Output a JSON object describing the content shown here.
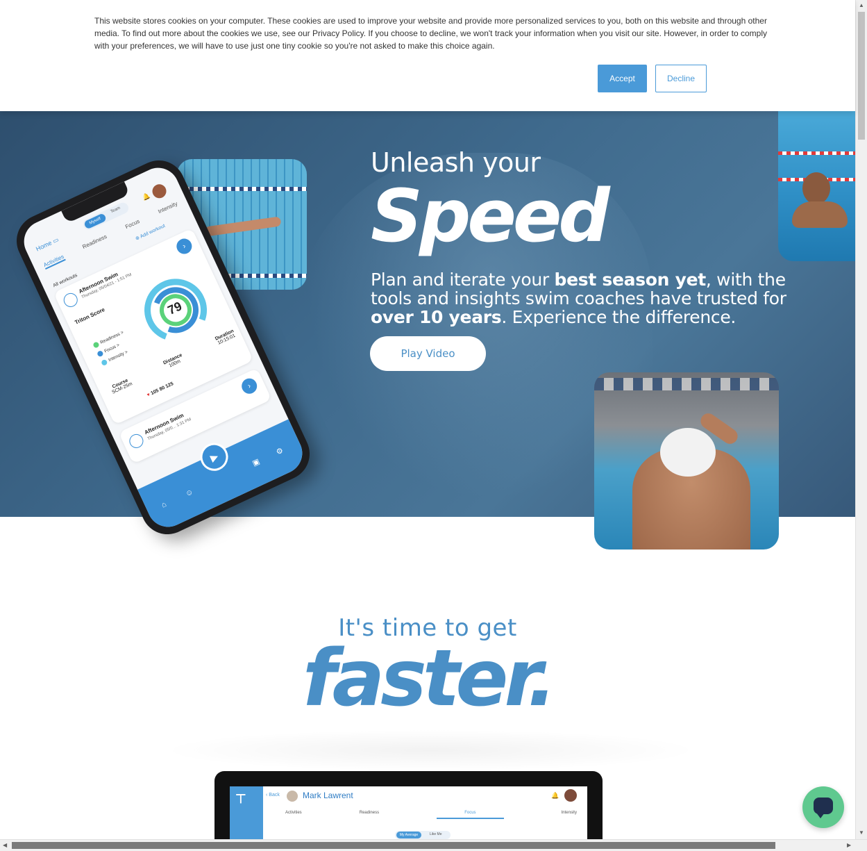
{
  "cookie_banner": {
    "text": "This website stores cookies on your computer. These cookies are used to improve your website and provide more personalized services to you, both on this website and through other media. To find out more about the cookies we use, see our Privacy Policy. If you choose to decline, we won't track your information when you visit our site. However, in order to comply with your preferences, we will have to use just one tiny cookie so you're not asked to make this choice again.",
    "accept_label": "Accept",
    "decline_label": "Decline"
  },
  "hero": {
    "title_small": "Unleash your",
    "title_big": "Speed",
    "body_part1": "Plan and iterate your ",
    "body_bold1": "best season yet",
    "body_part2": ", with the tools and insights swim coaches have trusted for ",
    "body_bold2": "over 10 years",
    "body_part3": ". Experience the difference.",
    "play_label": "Play Video"
  },
  "phone_app": {
    "home_label": "Home",
    "toggle_myself": "Myself",
    "toggle_team": "Team",
    "tabs": [
      "Activities",
      "Readiness",
      "Focus",
      "Intensity"
    ],
    "add_workout": "Add workout",
    "all_workouts": "All workouts",
    "workout_title": "Afternoon Swim",
    "workout_date": "Thursday, 05/04/21 - 1:51 PM",
    "score_label": "Triton Score",
    "score_value": "79",
    "legend": [
      "Readiness >",
      "Focus >",
      "Intensity >"
    ],
    "stats": [
      {
        "label": "Course",
        "value": "SCM-25m"
      },
      {
        "label": "Distance",
        "value": "100m"
      },
      {
        "label": "Duration",
        "value": "10:15:01"
      }
    ],
    "heart_rates": "105   80   125",
    "card2_title": "Afternoon Swim",
    "card2_date": "Thursday, 05/0...  1:31 PM"
  },
  "faster": {
    "small": "It's time to get",
    "big": "faster."
  },
  "laptop_app": {
    "back_label": "Back",
    "name": "Mark Lawrent",
    "tabs": [
      "Activities",
      "Readiness",
      "Focus",
      "Intensity"
    ],
    "pill_left": "My Average",
    "pill_right": "Like Me"
  },
  "colors": {
    "accent": "#4a9ad8",
    "hero_bg": "#3f6a8d",
    "chat_bg": "#5fc98f"
  },
  "icons": {
    "chat": "chat-bubble-icon",
    "bell": "bell-icon",
    "calendar": "calendar-icon",
    "play": "play-icon"
  }
}
